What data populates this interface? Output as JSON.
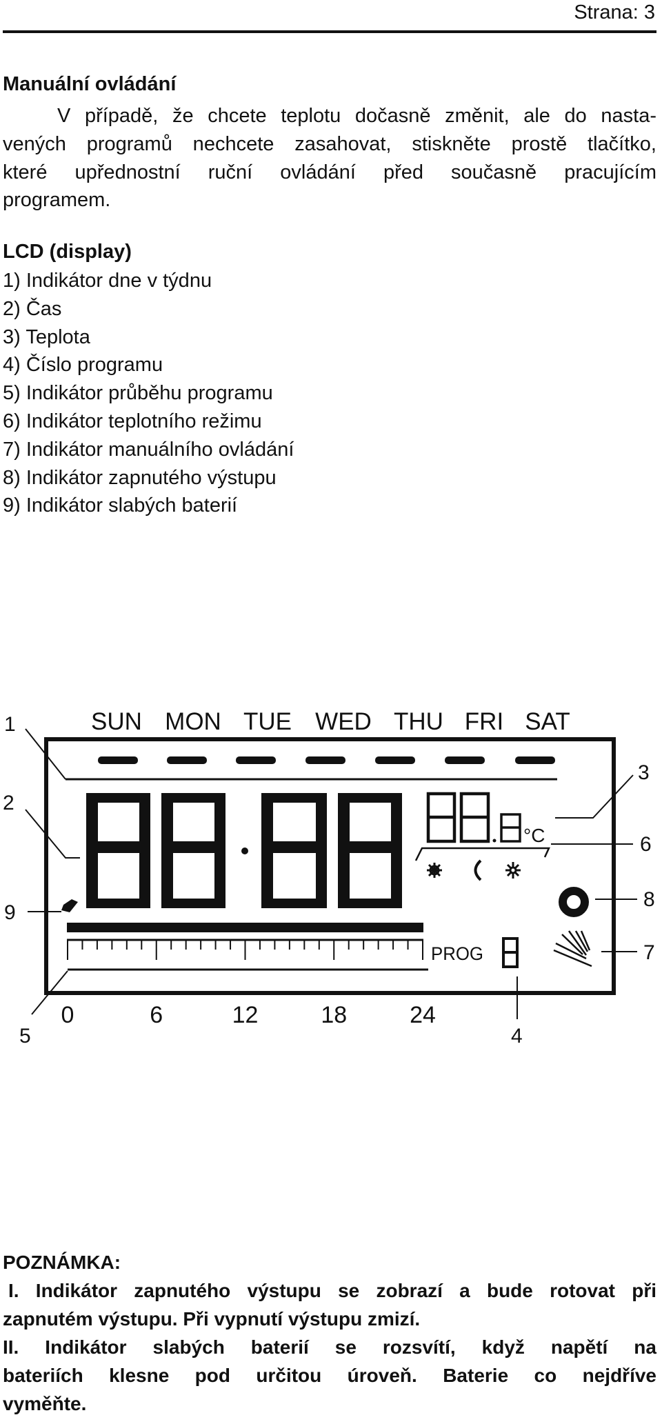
{
  "header": {
    "page_label": "Strana: 3"
  },
  "manual": {
    "title": "Manuální ovládání",
    "lines": [
      "V případě, že chcete teplotu dočasně změnit, ale do nasta-",
      "vených programů nechcete zasahovat, stiskněte prostě tlačítko,",
      "které upřednostní ruční ovládání před současně pracujícím",
      "programem."
    ]
  },
  "lcd": {
    "title": "LCD (display)",
    "items": [
      "1) Indikátor dne v týdnu",
      "2) Čas",
      "3) Teplota",
      "4) Číslo programu",
      "5) Indikátor průběhu programu",
      "6) Indikátor teplotního režimu",
      "7) Indikátor manuálního ovládání",
      "8) Indikátor zapnutého výstupu",
      "9) Indikátor slabých baterií"
    ]
  },
  "diagram": {
    "days": [
      "SUN",
      "MON",
      "TUE",
      "WED",
      "THU",
      "FRI",
      "SAT"
    ],
    "callouts": {
      "c1": "1",
      "c2": "2",
      "c3": "3",
      "c4": "4",
      "c5": "5",
      "c6": "6",
      "c7": "7",
      "c8": "8",
      "c9": "9"
    },
    "unit": "°C",
    "prog_label": "PROG",
    "hour_ticks": [
      "0",
      "6",
      "12",
      "18",
      "24"
    ],
    "mode_icons": [
      "sun-icon",
      "moon-icon",
      "snowflake-icon"
    ]
  },
  "note": {
    "title": "POZNÁMKA:",
    "lines": [
      "I. Indikátor zapnutého výstupu se zobrazí a bude rotovat při",
      "zapnutém výstupu. Při vypnutí výstupu zmizí.",
      "II. Indikátor slabých baterií se rozsvítí, když napětí na",
      "bateriích klesne pod určitou úroveň. Baterie co nejdříve",
      "vyměňte."
    ]
  }
}
